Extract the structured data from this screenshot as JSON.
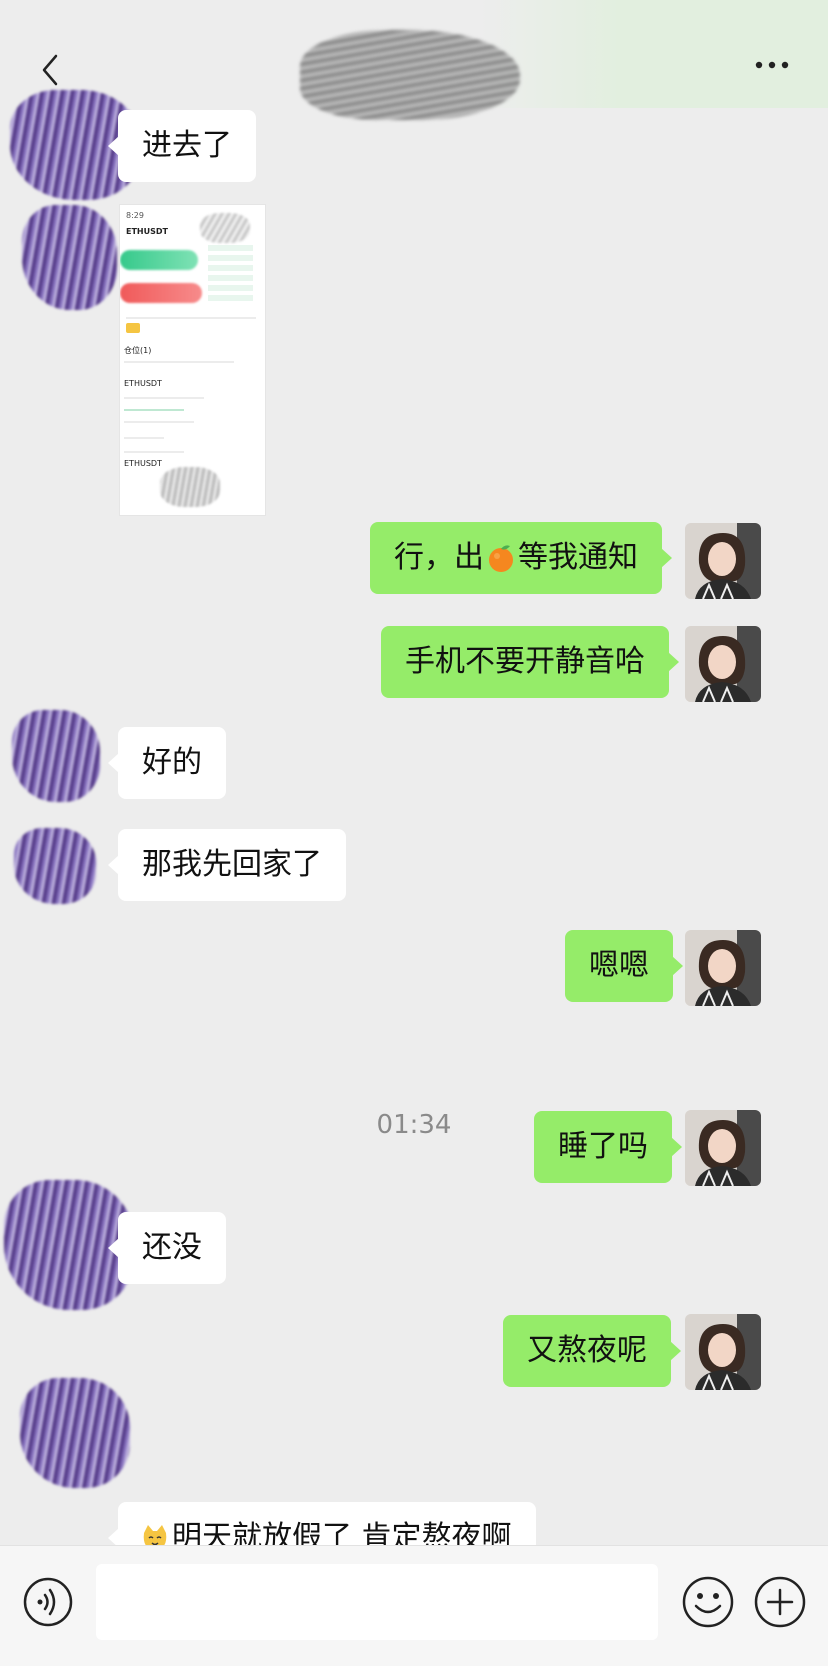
{
  "header": {
    "back_icon": "chevron-left-icon",
    "more_icon": "more-dots-icon"
  },
  "messages": [
    {
      "side": "left",
      "text": "进去了"
    },
    {
      "side": "left",
      "type": "image",
      "image_text": {
        "time": "8:29",
        "pair": "ETHUSDT",
        "label1": "ETHUSDT",
        "tab1": "仓位(1)",
        "bottom": "ETHUSDT"
      }
    },
    {
      "side": "right",
      "text_before": "行，出",
      "emoji": "tangerine",
      "text_after": "等我通知"
    },
    {
      "side": "right",
      "text": "手机不要开静音哈"
    },
    {
      "side": "left",
      "text": "好的"
    },
    {
      "side": "left",
      "text": "那我先回家了"
    },
    {
      "side": "right",
      "text": "嗯嗯"
    },
    {
      "side": "right",
      "text": "睡了吗"
    },
    {
      "side": "left",
      "text": "还没"
    },
    {
      "side": "right",
      "text": "又熬夜呢"
    },
    {
      "side": "left",
      "emoji": "cat-face",
      "text": "明天就放假了 肯定熬夜啊"
    }
  ],
  "time_label": "01:34",
  "toolbar": {
    "voice_icon": "voice-icon",
    "emoji_icon": "emoji-icon",
    "plus_icon": "plus-icon",
    "input_value": ""
  },
  "colors": {
    "background": "#ededed",
    "bubble_right": "#95ec69",
    "bubble_left": "#ffffff"
  }
}
